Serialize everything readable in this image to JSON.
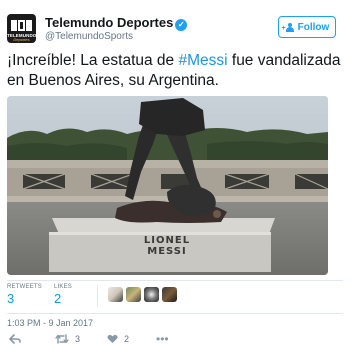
{
  "account": {
    "name": "Telemundo Deportes",
    "handle": "@TelemundoSports",
    "avatar_text": "TELEMUNDO",
    "avatar_subtext": "Deportes"
  },
  "follow_button": {
    "label": "Follow"
  },
  "tweet": {
    "text_before": "¡Increíble! La estatua de ",
    "hashtag": "#Messi",
    "text_after": " fue vandalizada en Buenos Aires, su Argentina."
  },
  "media": {
    "statue_label_line1": "LIONEL",
    "statue_label_line2": "MESSI"
  },
  "stats": {
    "retweets_label": "RETWEETS",
    "retweets_value": "3",
    "likes_label": "LIKES",
    "likes_value": "2"
  },
  "timestamp": "1:03 PM - 9 Jan 2017",
  "actions": {
    "retweet_count": "3",
    "like_count": "2"
  },
  "colors": {
    "accent": "#1da1f2",
    "link": "#1b95e0",
    "muted": "#657786",
    "divider": "#e1e8ed"
  }
}
